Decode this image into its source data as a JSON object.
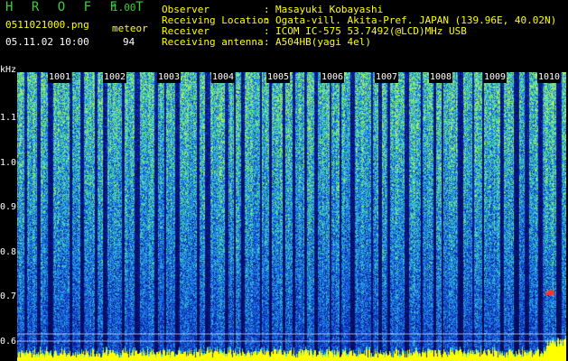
{
  "header": {
    "title": "H R O F F T",
    "version": "1.00",
    "file_name": "0511021000.png",
    "event_label": "meteor",
    "timestamp": "05.11.02 10:00",
    "event_count": "94"
  },
  "station_info": [
    {
      "label": "Observer",
      "value": "Masayuki Kobayashi"
    },
    {
      "label": "Receiving Location",
      "value": "Ogata-vill. Akita-Pref. JAPAN (139.96E, 40.02N)"
    },
    {
      "label": "Receiver",
      "value": "ICOM IC-575 53.7492(@LCD)MHz USB"
    },
    {
      "label": "Receiving antenna",
      "value": "A504HB(yagi 4el)"
    }
  ],
  "axes": {
    "frequency_unit": "kHz",
    "frequency_ticks": [
      "1.1",
      "1.0",
      "0.9",
      "0.8",
      "0.7",
      "0.6"
    ],
    "time_ticks": [
      "1001",
      "1002",
      "1003",
      "1004",
      "1005",
      "1006",
      "1007",
      "1008",
      "1009",
      "1010"
    ]
  },
  "colors": {
    "background": "#000000",
    "header_green": "#3ccf3c",
    "header_yellow": "#ffff00",
    "spectrum_low": "#07126e",
    "spectrum_mid": "#1e7ae0",
    "spectrum_high": "#3cd8b0",
    "echo_red": "#ff3030",
    "trace_yellow": "#ffff00"
  }
}
